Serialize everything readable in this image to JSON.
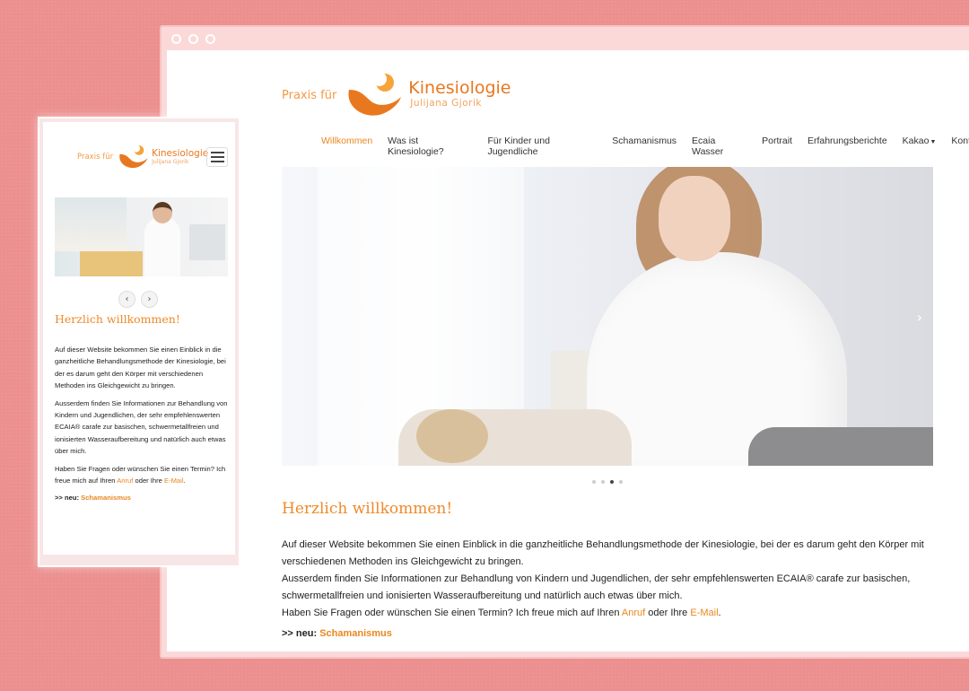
{
  "logo": {
    "prefix": "Praxis für",
    "name": "Kinesiologie",
    "owner": "Julijana Gjorik"
  },
  "nav": {
    "items": [
      "Willkommen",
      "Was ist Kinesiologie?",
      "Für Kinder und Jugendliche",
      "Schamanismus",
      "Ecaia Wasser",
      "Portrait",
      "Erfahrungsberichte",
      "Kakao",
      "Kontakt"
    ],
    "active_index": 0
  },
  "carousel": {
    "slides": 4,
    "active_slide": 3
  },
  "content": {
    "heading": "Herzlich willkommen!",
    "p1": "Auf dieser Website bekommen Sie einen Einblick in die ganzheitliche Behandlungsmethode der Kinesiologie, bei der es darum geht den Körper mit verschiedenen Methoden ins Gleichgewicht zu bringen.",
    "p2": "Ausserdem finden Sie Informationen zur Behandlung von Kindern und Jugendlichen, der sehr empfehlenswerten ECAIA® carafe zur basischen, schwermetallfreien und ionisierten Wasseraufbereitung und natürlich auch etwas über mich.",
    "p3_start": "Haben Sie Fragen oder wünschen Sie einen Termin? Ich freue mich auf Ihren ",
    "p3_link1": "Anruf",
    "p3_mid": " oder Ihre ",
    "p3_link2": "E-Mail",
    "p3_end": ".",
    "news_prefix": ">> neu: ",
    "news_link": "Schamanismus"
  },
  "colors": {
    "accent": "#e8871f",
    "background": "#ec8f8f",
    "logo": "#e8781f"
  }
}
